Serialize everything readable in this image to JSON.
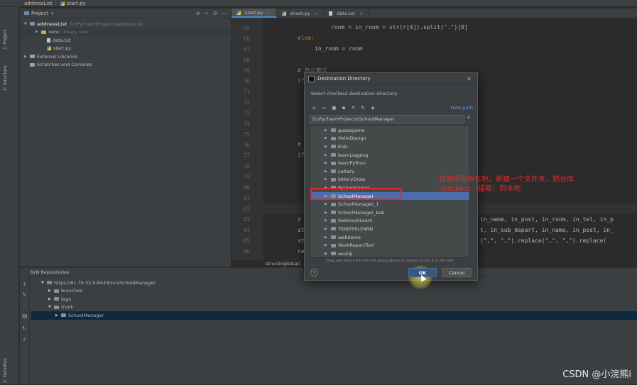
{
  "titlebar": {
    "project": "addressList",
    "file": "start.py"
  },
  "left_strip": {
    "tab_project": "1: Project",
    "tab_structure": "2: Structure",
    "tab_favorites": "2: Favorites"
  },
  "project_panel": {
    "header": "Project",
    "tree": [
      {
        "label": "addressList",
        "hint": "D:\\PycharmProjects\\addressList"
      },
      {
        "label": "venv",
        "hint": "library root"
      },
      {
        "label": "data.txt"
      },
      {
        "label": "start.py"
      },
      {
        "label": "External Libraries"
      },
      {
        "label": "Scratches and Consoles"
      }
    ]
  },
  "editor": {
    "tabs": [
      {
        "label": "start.py"
      },
      {
        "label": "sheet.py"
      },
      {
        "label": "data.txt"
      }
    ],
    "line_numbers": [
      "65",
      "66",
      "67",
      "68",
      "69",
      "70",
      "71",
      "72",
      "73",
      "74",
      "75",
      "76",
      "77",
      "78",
      "79",
      "80",
      "81",
      "82",
      "83",
      "84",
      "85",
      "86"
    ],
    "code": {
      "l65": "room = in_room = str(r[4]).split(\".\")[0]",
      "l66": "else:",
      "l67": "in_room = room",
      "l69": "# 办公电话",
      "l70": "if",
      "l76": "#",
      "l77": "if",
      "l83": "#",
      "l83_tail": "in_name, in_post, in_room, in_tel, in_p",
      "l84": "st",
      "l84_tail": "t, in_sub_depart, in_name, in_post, in_",
      "l85": "st",
      "l85_tail": "(\",\", \",\").replace(\",\", \",\").replace(",
      "l86": "re"
    },
    "breadcrumb": "structingData()"
  },
  "svn": {
    "header": "SVN Repositories",
    "tree": [
      {
        "label": "https://81.70.32.9:8443/svn/SchoolManager"
      },
      {
        "label": "branches"
      },
      {
        "label": "tags"
      },
      {
        "label": "trunk"
      },
      {
        "label": "SchoolManager"
      }
    ]
  },
  "dialog": {
    "title": "Destination Directory",
    "subtitle": "Select checkout destination directory",
    "hide_path": "Hide path",
    "path": "D:\\PycharmProjects\\SchoolManager",
    "folders": [
      "guessgame",
      "HelloDjango",
      "Kids",
      "learnLogging",
      "learnPython",
      "Lottery",
      "lotteryDraw",
      "PythonDemos",
      "SchoolManager",
      "SchoolManager_1",
      "SchoolManager_bak",
      "SeleniumLearn",
      "TKINTERLEARN",
      "webdemo",
      "WorkReportTool",
      "wuziqi"
    ],
    "selected_folder": "SchoolManager",
    "hint": "Drag and drop a file into the space above to quickly locate it in the tree",
    "help": "?",
    "ok": "OK",
    "cancel": "Cancel"
  },
  "annotation": {
    "text": "找到项目所在地，新建一个文件夹，把仓库checkout（提取）到本地",
    "color": "#e8282b"
  },
  "watermark": "CSDN @小浣熊i",
  "colors": {
    "accent": "#4a88c7",
    "selection": "#4b6eaf",
    "ok_button": "#365880"
  }
}
